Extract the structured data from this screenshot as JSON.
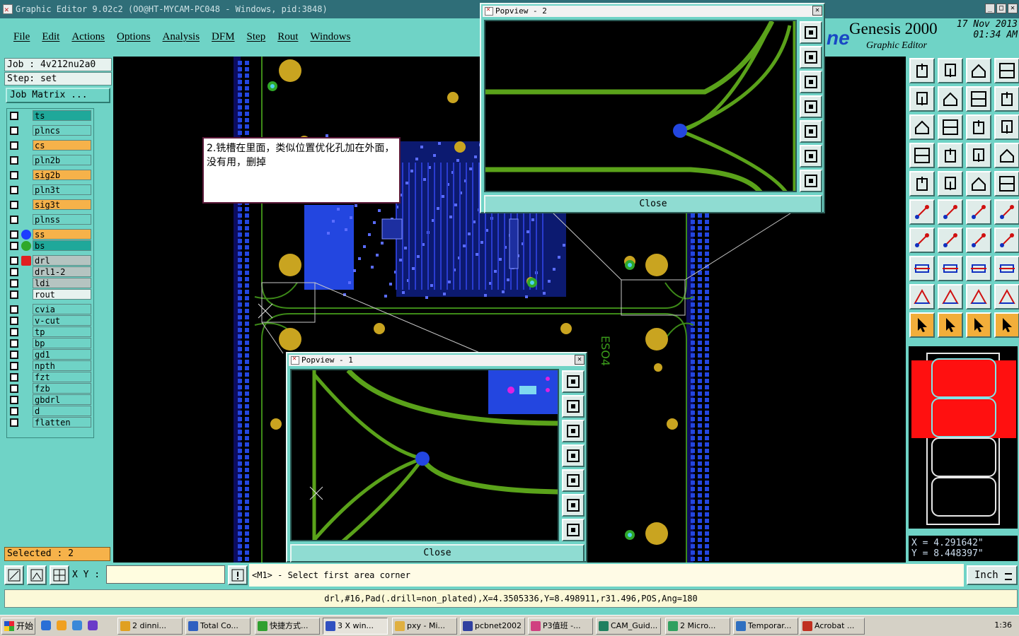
{
  "window": {
    "title": "Graphic Editor 9.02c2  (OO@HT-MYCAM-PC048 - Windows, pid:3848)"
  },
  "menu": [
    "File",
    "Edit",
    "Actions",
    "Options",
    "Analysis",
    "DFM",
    "Step",
    "Rout",
    "Windows"
  ],
  "brand": {
    "logo_fragment": "ne",
    "product": "Genesis 2000",
    "subtitle": "Graphic Editor",
    "date": "17 Nov 2013",
    "time": "01:34 AM"
  },
  "job": {
    "job": "Job : 4v212nu2a0",
    "step": "Step: set",
    "matrix_button": "Job Matrix ..."
  },
  "layers": [
    {
      "name": "ts",
      "color": "#1fa89a",
      "mark": ""
    },
    {
      "name": "plncs",
      "color": "#6fd3c6",
      "mark": ""
    },
    {
      "name": "cs",
      "color": "#f6b24a",
      "mark": ""
    },
    {
      "name": "pln2b",
      "color": "#6fd3c6",
      "mark": ""
    },
    {
      "name": "sig2b",
      "color": "#f6b24a",
      "mark": ""
    },
    {
      "name": "pln3t",
      "color": "#6fd3c6",
      "mark": ""
    },
    {
      "name": "sig3t",
      "color": "#f6b24a",
      "mark": ""
    },
    {
      "name": "plnss",
      "color": "#6fd3c6",
      "mark": ""
    },
    {
      "name": "ss",
      "color": "#f6b24a",
      "mark": "#1d3cff"
    },
    {
      "name": "bs",
      "color": "#1fa89a",
      "mark": "#2fa82a"
    },
    {
      "name": "drl",
      "color": "#b5c4c1",
      "mark": "edit"
    },
    {
      "name": "drl1-2",
      "color": "#b5c4c1",
      "mark": ""
    },
    {
      "name": "ldi",
      "color": "#b5c4c1",
      "mark": ""
    },
    {
      "name": "rout",
      "color": "#e7f2ef",
      "mark": ""
    },
    {
      "name": "cvia",
      "color": "#6fd3c6",
      "mark": ""
    },
    {
      "name": "v-cut",
      "color": "#6fd3c6",
      "mark": ""
    },
    {
      "name": "tp",
      "color": "#6fd3c6",
      "mark": ""
    },
    {
      "name": "bp",
      "color": "#6fd3c6",
      "mark": ""
    },
    {
      "name": "gd1",
      "color": "#6fd3c6",
      "mark": ""
    },
    {
      "name": "npth",
      "color": "#6fd3c6",
      "mark": ""
    },
    {
      "name": "fzt",
      "color": "#6fd3c6",
      "mark": ""
    },
    {
      "name": "fzb",
      "color": "#6fd3c6",
      "mark": ""
    },
    {
      "name": "gbdrl",
      "color": "#6fd3c6",
      "mark": ""
    },
    {
      "name": "d",
      "color": "#6fd3c6",
      "mark": ""
    },
    {
      "name": "flatten",
      "color": "#6fd3c6",
      "mark": ""
    }
  ],
  "selected": "Selected : 2",
  "annotation": "2.铣槽在里面，类似位置优化孔加在外面，没有用，删掉",
  "popview1": {
    "title": "Popview - 1",
    "close_label": "Close"
  },
  "popview2": {
    "title": "Popview - 2",
    "close_label": "Close"
  },
  "coords": {
    "x": "X = 4.291642\"",
    "y": "Y = 8.448397\""
  },
  "cmd": {
    "xy_label": "X Y :",
    "xy_value": "",
    "prompt": "<M1> - Select first area corner",
    "unit": "Inch"
  },
  "status": "drl,#16,Pad(.drill=non_plated),X=4.3505336,Y=8.498911,r31.496,POS,Ang=180",
  "taskbar": {
    "start": "开始",
    "tasks": [
      "2 dinni...",
      "Total Co...",
      "快捷方式...",
      "3 X win...",
      "pxy - Mi...",
      "pcbnet2002",
      "P3值班 -...",
      "CAM_Guid...",
      "2 Micro...",
      "Temporar...",
      "Acrobat ..."
    ],
    "clock": "1:36"
  },
  "colors": {
    "panel": "#6fd3c6",
    "copper_green": "#5aa21a",
    "pad_blue": "#1d3cff",
    "pad_gold": "#c9a420",
    "cs_orange": "#f6b24a"
  }
}
